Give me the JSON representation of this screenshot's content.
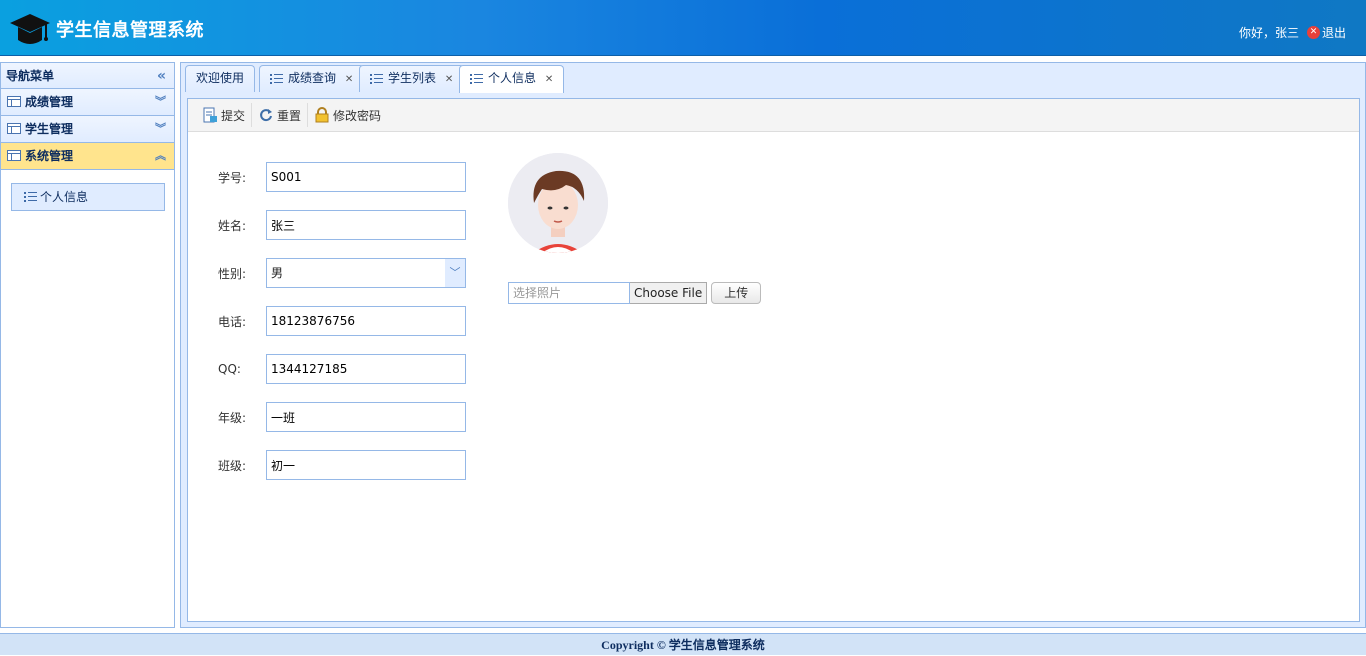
{
  "header": {
    "title": "学生信息管理系统",
    "greeting": "你好，张三",
    "logout_label": "退出"
  },
  "sidebar": {
    "title": "导航菜单",
    "sections": [
      {
        "label": "成绩管理",
        "expanded": false
      },
      {
        "label": "学生管理",
        "expanded": false
      },
      {
        "label": "系统管理",
        "expanded": true
      }
    ],
    "active_item": "个人信息"
  },
  "tabs": [
    {
      "label": "欢迎使用",
      "closable": false
    },
    {
      "label": "成绩查询",
      "closable": true
    },
    {
      "label": "学生列表",
      "closable": true
    },
    {
      "label": "个人信息",
      "closable": true,
      "active": true
    }
  ],
  "toolbar": {
    "submit_label": "提交",
    "reset_label": "重置",
    "change_password_label": "修改密码"
  },
  "form": {
    "student_id": {
      "label": "学号:",
      "value": "S001"
    },
    "name": {
      "label": "姓名:",
      "value": "张三"
    },
    "gender": {
      "label": "性别:",
      "value": "男"
    },
    "phone": {
      "label": "电话:",
      "value": "18123876756"
    },
    "qq": {
      "label": "QQ:",
      "value": "1344127185"
    },
    "grade": {
      "label": "年级:",
      "value": "一班"
    },
    "class": {
      "label": "班级:",
      "value": "初一"
    }
  },
  "photo": {
    "placeholder": "选择照片",
    "choose_label": "Choose File",
    "upload_label": "上传"
  },
  "footer": {
    "text": "Copyright © 学生信息管理系统"
  }
}
